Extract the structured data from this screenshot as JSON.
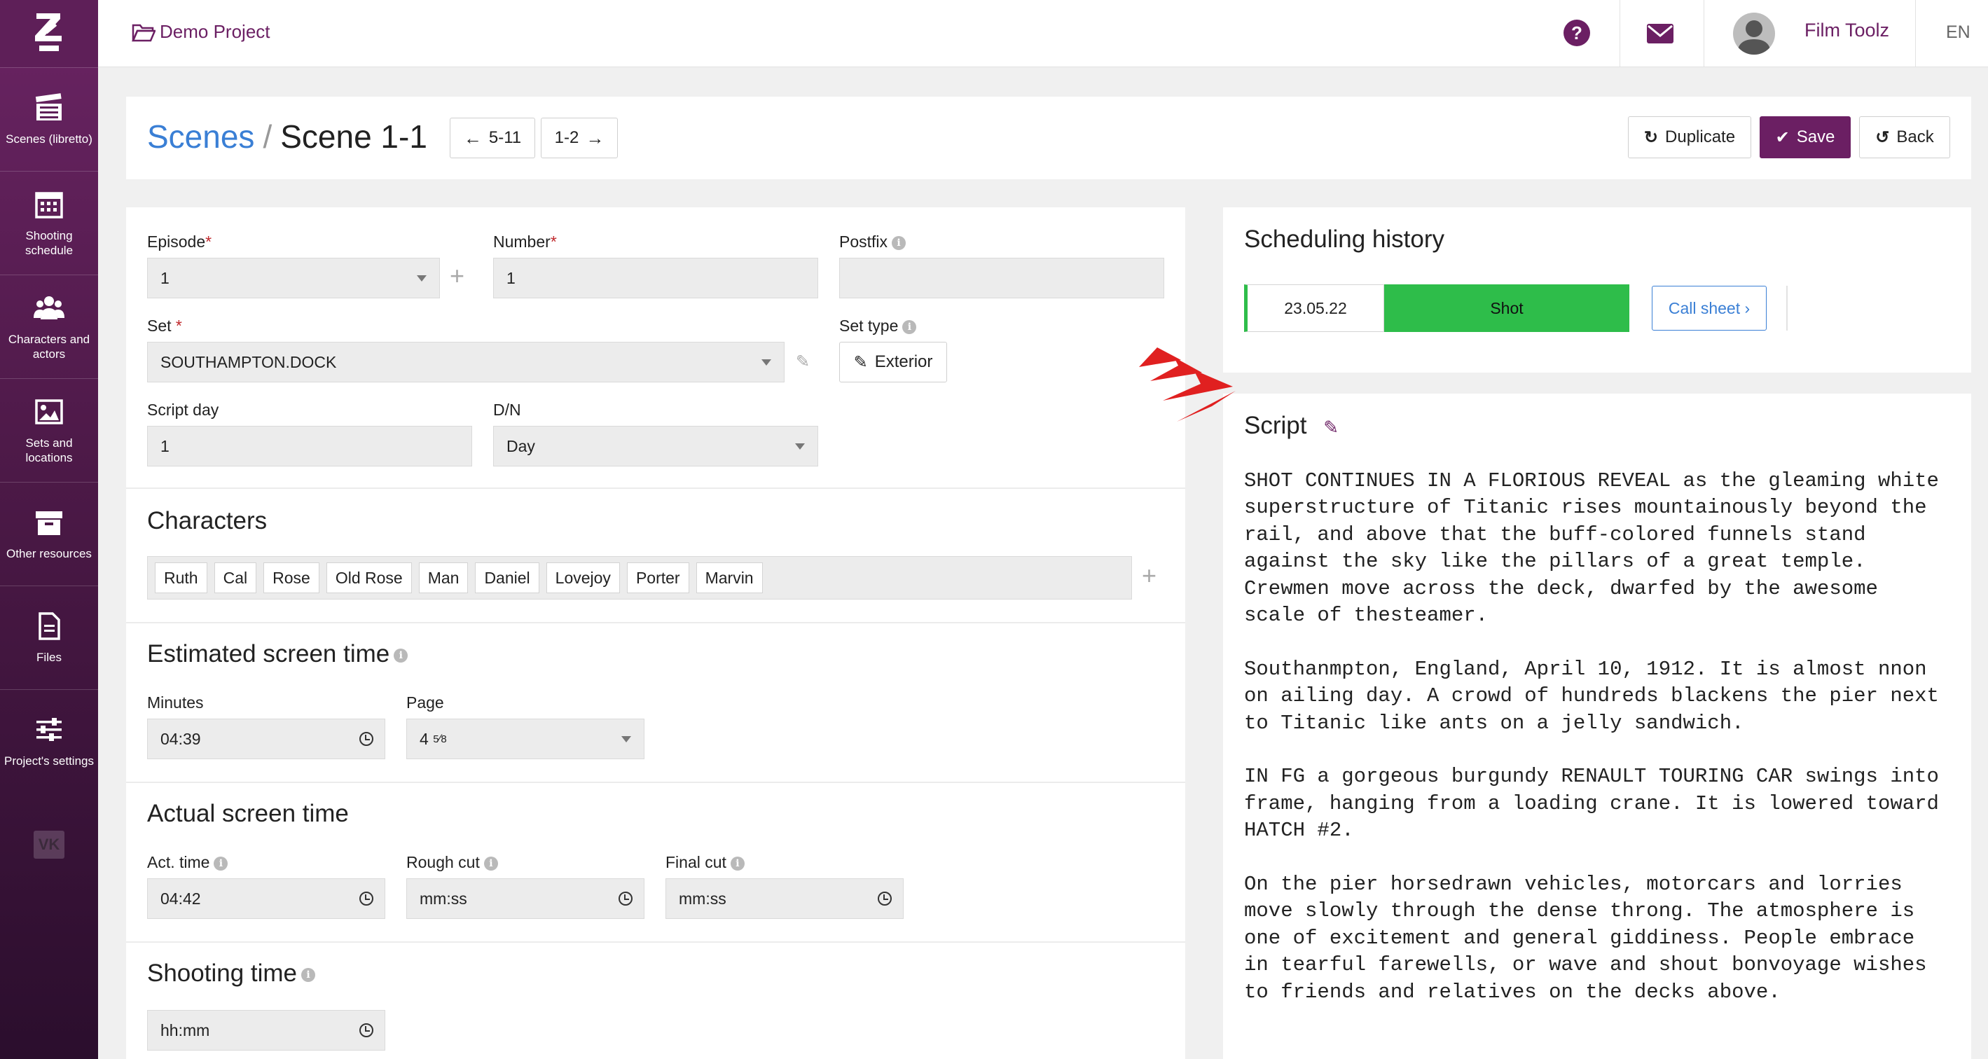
{
  "nav": {
    "items": [
      {
        "label": "Scenes (libretto)",
        "icon": "clapperboard-icon"
      },
      {
        "label": "Shooting schedule",
        "icon": "calendar-icon"
      },
      {
        "label": "Characters and actors",
        "icon": "users-icon"
      },
      {
        "label": "Sets and locations",
        "icon": "image-icon"
      },
      {
        "label": "Other resources",
        "icon": "archive-icon"
      },
      {
        "label": "Files",
        "icon": "file-icon"
      },
      {
        "label": "Project's settings",
        "icon": "sliders-icon"
      }
    ],
    "vk": "VK"
  },
  "topbar": {
    "project": "Demo Project",
    "help": "?",
    "user": "Film Toolz",
    "lang": "EN"
  },
  "header": {
    "crumb_parent": "Scenes",
    "crumb_sep": "/",
    "crumb_current": "Scene 1-1",
    "prev_label": "5-11",
    "next_label": "1-2",
    "duplicate_label": "Duplicate",
    "save_label": "Save",
    "back_label": "Back"
  },
  "form": {
    "episode": {
      "label": "Episode",
      "value": "1"
    },
    "number": {
      "label": "Number",
      "value": "1"
    },
    "postfix": {
      "label": "Postfix",
      "value": ""
    },
    "set": {
      "label": "Set",
      "value": "SOUTHAMPTON.DOCK"
    },
    "set_type": {
      "label": "Set type",
      "value": "Exterior"
    },
    "script_day": {
      "label": "Script day",
      "value": "1"
    },
    "dn": {
      "label": "D/N",
      "value": "Day"
    },
    "required_mark": "*"
  },
  "characters": {
    "title": "Characters",
    "list": [
      "Ruth",
      "Cal",
      "Rose",
      "Old Rose",
      "Man",
      "Daniel",
      "Lovejoy",
      "Porter",
      "Marvin"
    ]
  },
  "estimated": {
    "title": "Estimated screen time",
    "minutes_label": "Minutes",
    "minutes_value": "04:39",
    "page_label": "Page",
    "page_whole": "4",
    "page_num": "5",
    "page_den": "8"
  },
  "actual": {
    "title": "Actual screen time",
    "act_label": "Act. time",
    "act_value": "04:42",
    "rough_label": "Rough cut",
    "rough_value": "mm:ss",
    "final_label": "Final cut",
    "final_value": "mm:ss"
  },
  "shooting": {
    "title": "Shooting time",
    "value": "hh:mm"
  },
  "scheduling": {
    "title": "Scheduling history",
    "date": "23.05.22",
    "status": "Shot",
    "call_sheet": "Call sheet",
    "status_color": "#2ebd4a"
  },
  "script": {
    "title": "Script",
    "paragraphs": [
      "SHOT CONTINUES IN A FLORIOUS REVEAL as the gleaming white superstructure of Titanic rises mountainously beyond the rail, and above that the buff-colored funnels stand against the sky like the pillars of a great temple. Crewmen move across the deck, dwarfed by the awesome scale of thesteamer.",
      "Southanmpton, England, April 10, 1912. It is almost nnon on ailing day. A crowd of hundreds blackens the pier next to Titanic like ants on a jelly sandwich.",
      "IN FG a gorgeous burgundy RENAULT TOURING CAR swings into frame, hanging from a loading crane. It is lowered toward HATCH #2.",
      "On the pier horsedrawn vehicles, motorcars and lorries move slowly through the dense throng. The atmosphere is one of excitement and general giddiness. People embrace in tearful farewells, or wave and shout bonvoyage wishes to friends and relatives on the decks above."
    ]
  },
  "colors": {
    "brand": "#6b1f63",
    "link": "#3a7fd5",
    "arrow": "#e02020"
  }
}
